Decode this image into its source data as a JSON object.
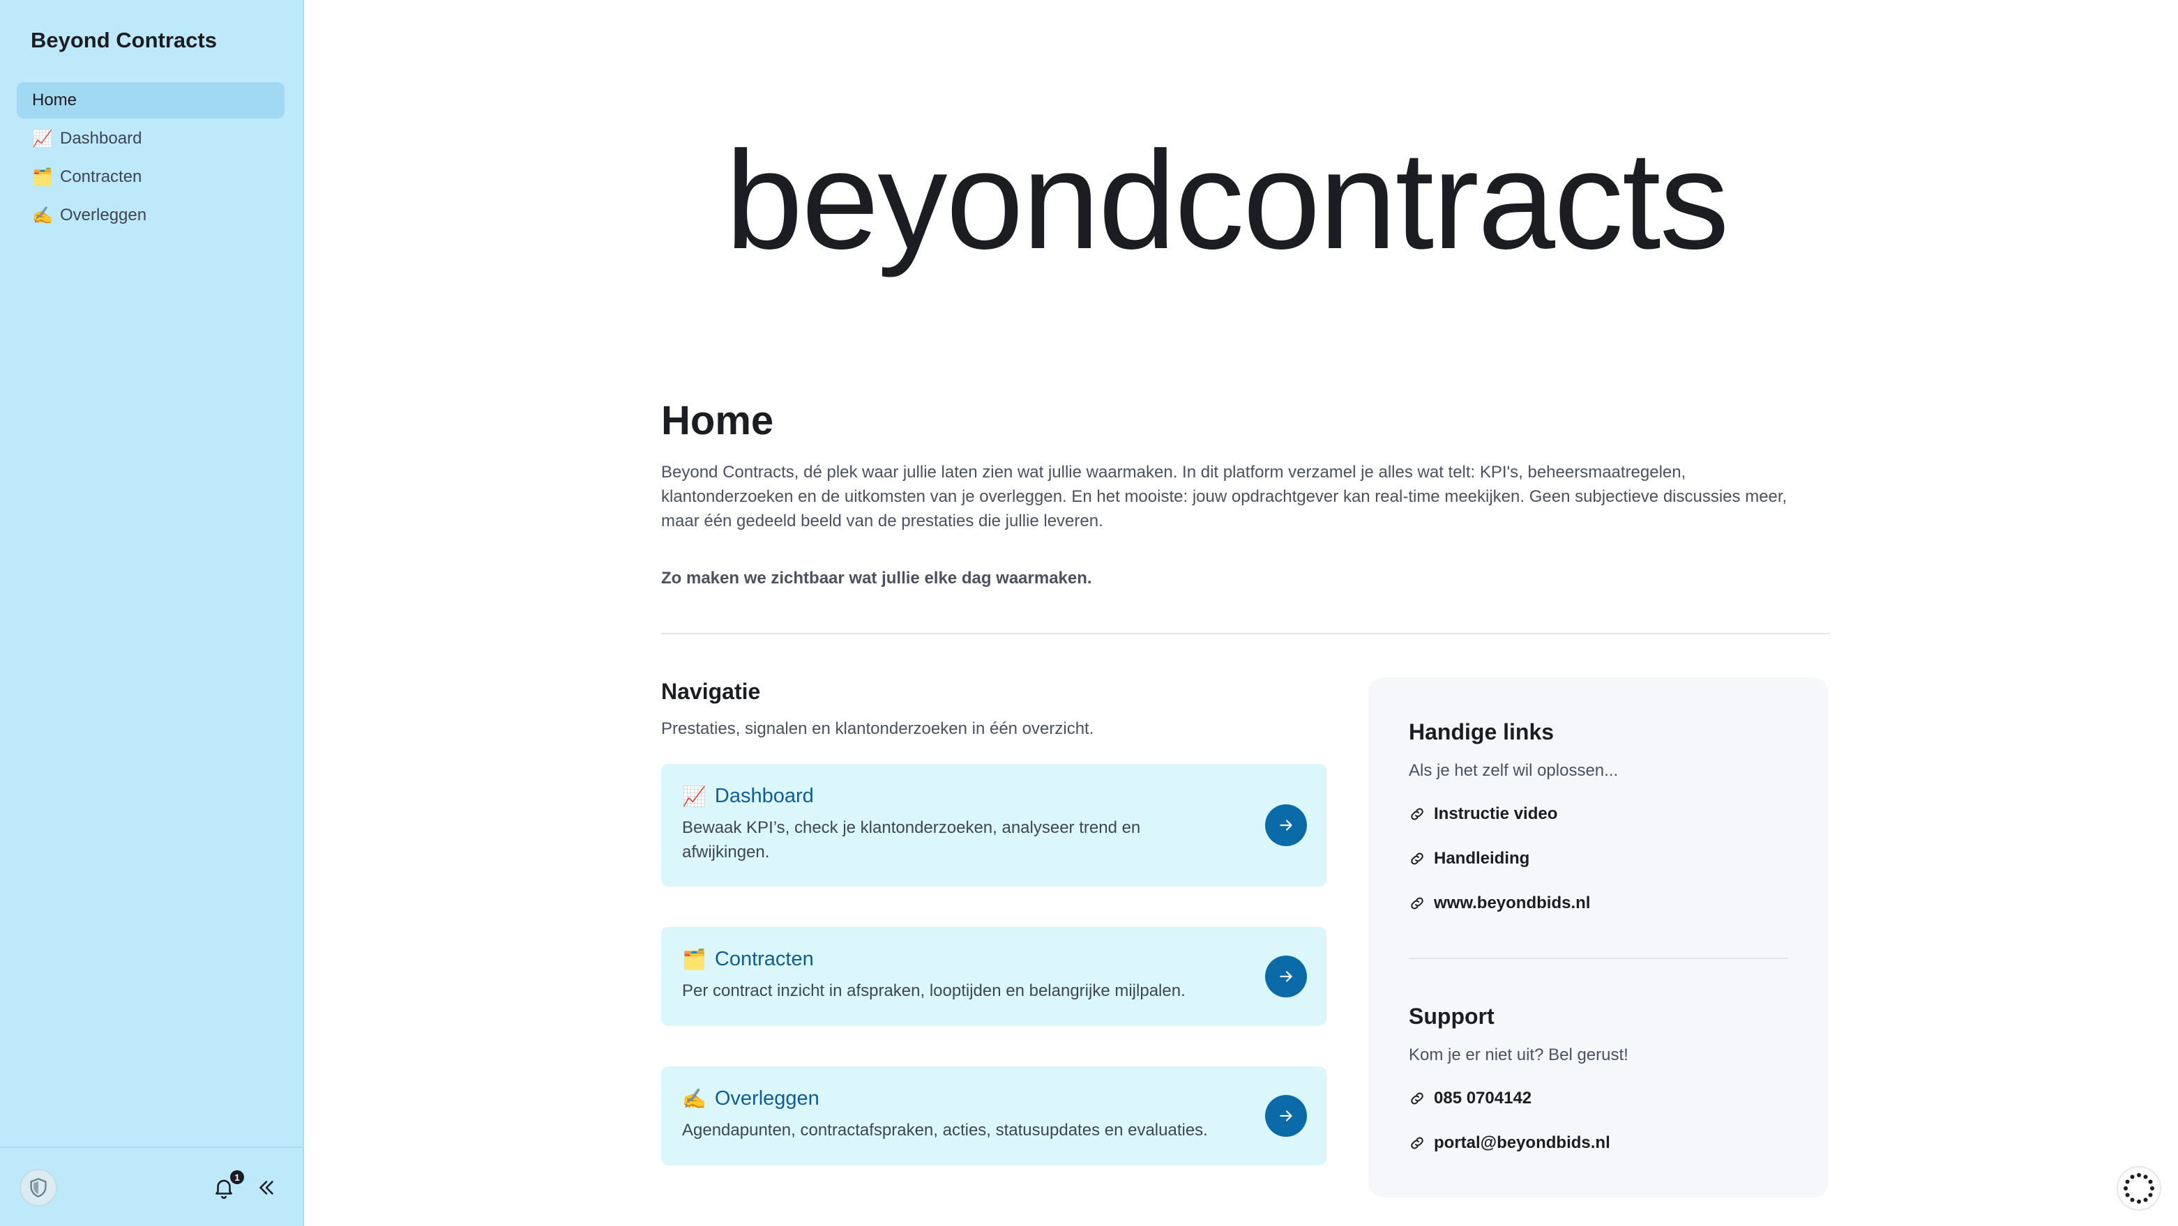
{
  "sidebar": {
    "app_title": "Beyond Contracts",
    "items": [
      {
        "label": "Home",
        "icon": "",
        "active": true
      },
      {
        "label": "Dashboard",
        "icon": "📈",
        "active": false
      },
      {
        "label": "Contracten",
        "icon": "🗂️",
        "active": false
      },
      {
        "label": "Overleggen",
        "icon": "✍️",
        "active": false
      }
    ],
    "footer": {
      "notification_count": "1",
      "icons": [
        "shield-icon",
        "bell-icon",
        "collapse-icon"
      ]
    }
  },
  "main": {
    "logo_text": "beyondcontracts",
    "title": "Home",
    "intro": "Beyond Contracts, dé plek waar jullie laten zien wat jullie waarmaken. In dit platform verzamel je alles wat telt: KPI's, beheersmaatregelen, klantonderzoeken en de uitkomsten van je overleggen. En het mooiste: jouw opdrachtgever kan real-time meekijken. Geen subjectieve discussies meer, maar één gedeeld beeld van de prestaties die jullie leveren.",
    "tagline": "Zo maken we zichtbaar wat jullie elke dag waarmaken.",
    "navigation": {
      "heading": "Navigatie",
      "subtitle": "Prestaties, signalen en klantonderzoeken in één overzicht.",
      "cards": [
        {
          "icon": "📈",
          "title": "Dashboard",
          "description": "Bewaak KPI’s, check je klantonderzoeken, analyseer trend en afwijkingen."
        },
        {
          "icon": "🗂️",
          "title": "Contracten",
          "description": "Per contract inzicht in afspraken, looptijden en belangrijke mijlpalen."
        },
        {
          "icon": "✍️",
          "title": "Overleggen",
          "description": "Agendapunten, contractafspraken, acties, statusupdates en evaluaties."
        }
      ]
    },
    "links_panel": {
      "heading": "Handige links",
      "subtitle": "Als je het zelf wil oplossen...",
      "links": [
        "Instructie video",
        "Handleiding",
        "www.beyondbids.nl"
      ]
    },
    "support_panel": {
      "heading": "Support",
      "subtitle": "Kom je er niet uit? Bel gerust!",
      "links": [
        "085 0704142",
        "portal@beyondbids.nl"
      ]
    }
  },
  "colors": {
    "sidebar_bg": "#bde9fb",
    "active_item": "#a1d8f2",
    "card_bg": "#dcf7fc",
    "accent": "#0b6aa8",
    "card_title": "#0e5d96",
    "panel_bg": "#f5f7fb"
  }
}
